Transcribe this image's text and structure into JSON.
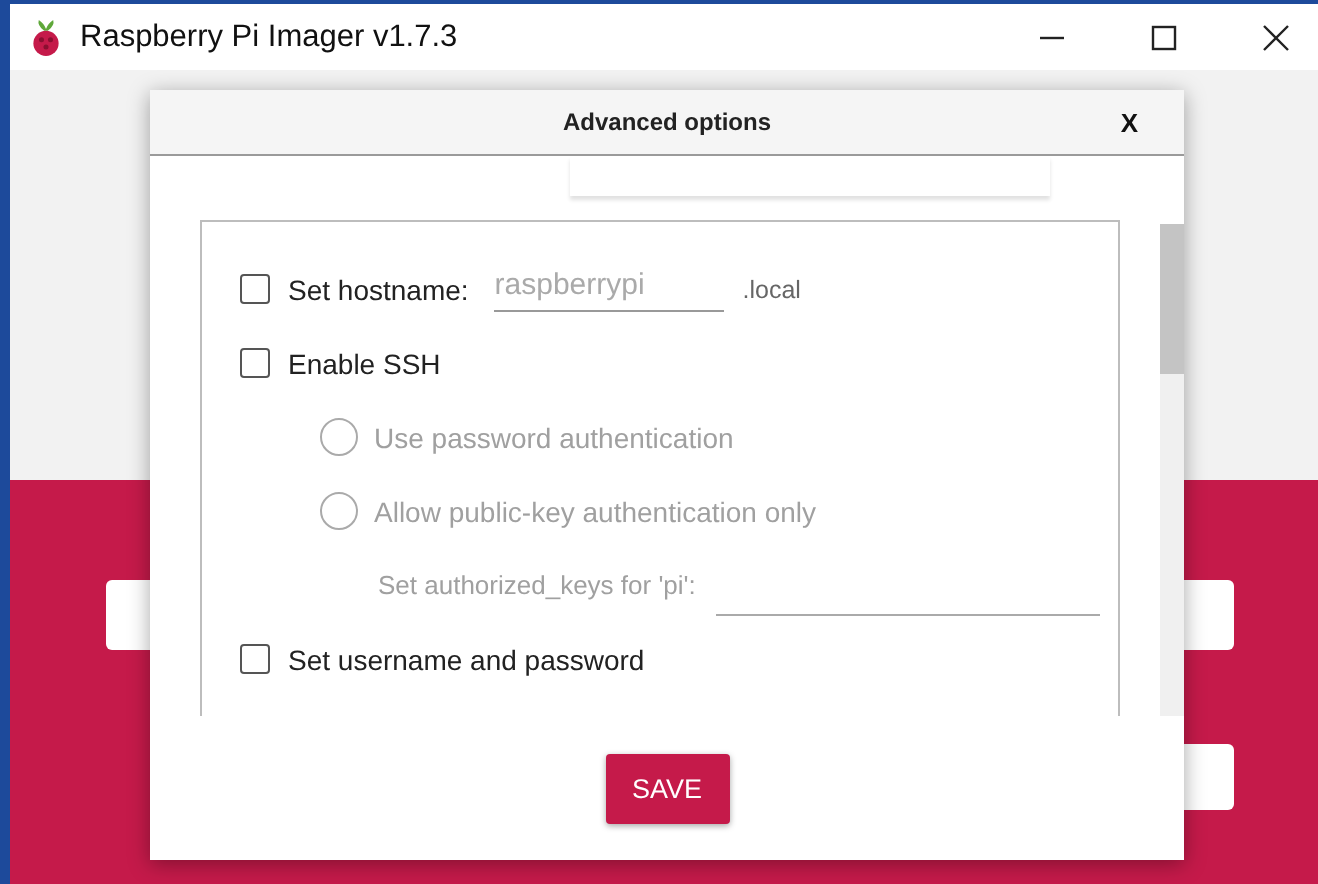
{
  "window": {
    "title": "Raspberry Pi Imager v1.7.3"
  },
  "dialog": {
    "title": "Advanced options",
    "close": "X",
    "options": [
      {
        "kind": "checkbox",
        "label": "Set hostname:",
        "checked": false,
        "field": {
          "value": "raspberrypi",
          "disabled": true
        },
        "suffix": ".local"
      },
      {
        "kind": "checkbox",
        "label": "Enable SSH",
        "checked": false
      },
      {
        "kind": "radio",
        "label": "Use password authentication",
        "selected": false,
        "disabled": true
      },
      {
        "kind": "radio",
        "label": "Allow public-key authentication only",
        "selected": false,
        "disabled": true
      },
      {
        "kind": "keyfield",
        "label": "Set authorized_keys for 'pi':",
        "disabled": true
      },
      {
        "kind": "checkbox",
        "label": "Set username and password",
        "checked": false
      }
    ],
    "save": "SAVE"
  }
}
